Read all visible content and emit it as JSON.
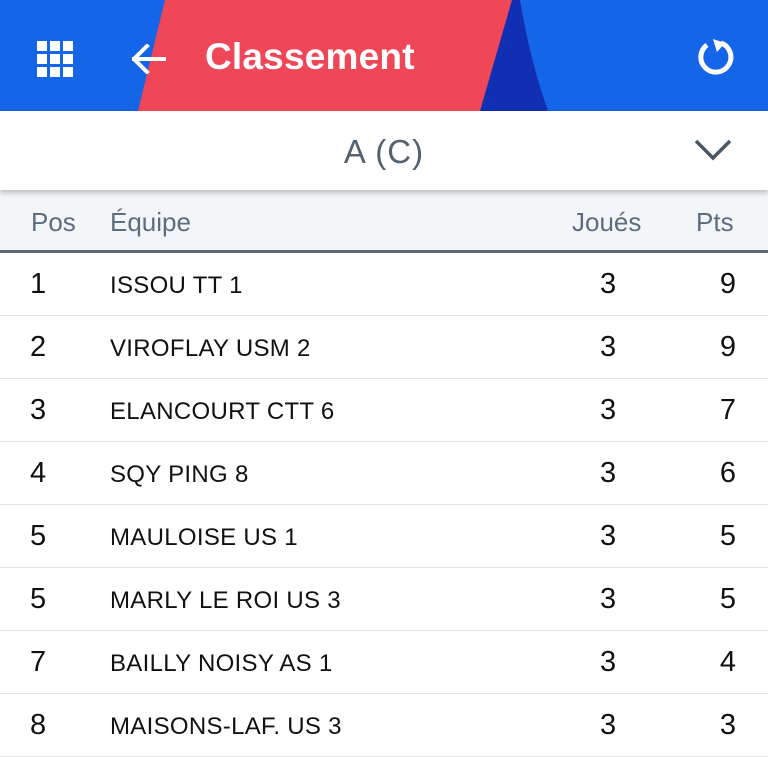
{
  "appbar": {
    "title": "Classement",
    "apps_icon": "apps-grid-icon",
    "back_icon": "arrow-left-icon",
    "refresh_icon": "refresh-icon",
    "colors": {
      "blue": "#1565e8",
      "red": "#ef4658",
      "navy": "#102fb3"
    }
  },
  "selector": {
    "value": "A (C)",
    "icon": "chevron-down-icon"
  },
  "table": {
    "headers": {
      "pos": "Pos",
      "team": "Équipe",
      "played": "Joués",
      "pts": "Pts"
    },
    "rows": [
      {
        "pos": "1",
        "team": "ISSOU TT 1",
        "played": "3",
        "pts": "9"
      },
      {
        "pos": "2",
        "team": "VIROFLAY USM 2",
        "played": "3",
        "pts": "9"
      },
      {
        "pos": "3",
        "team": "ELANCOURT CTT 6",
        "played": "3",
        "pts": "7"
      },
      {
        "pos": "4",
        "team": "SQY PING 8",
        "played": "3",
        "pts": "6"
      },
      {
        "pos": "5",
        "team": "MAULOISE US 1",
        "played": "3",
        "pts": "5"
      },
      {
        "pos": "5",
        "team": "MARLY LE ROI US 3",
        "played": "3",
        "pts": "5"
      },
      {
        "pos": "7",
        "team": "BAILLY NOISY AS 1",
        "played": "3",
        "pts": "4"
      },
      {
        "pos": "8",
        "team": "MAISONS-LAF. US 3",
        "played": "3",
        "pts": "3"
      }
    ]
  }
}
